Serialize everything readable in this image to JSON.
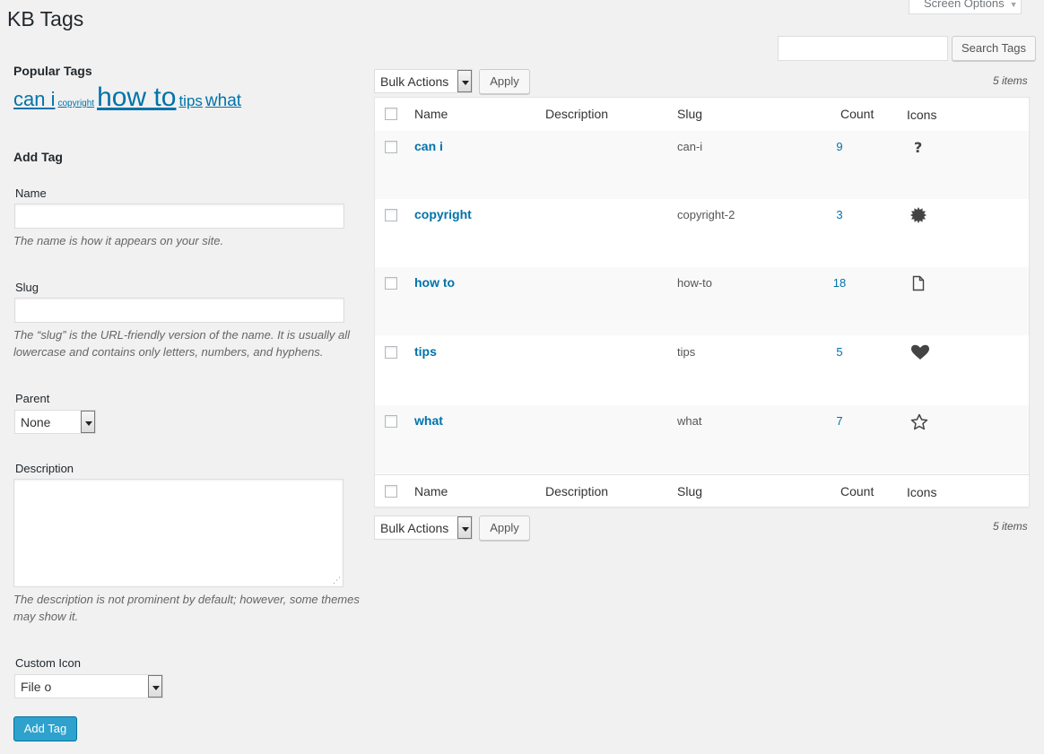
{
  "page": {
    "title": "KB Tags"
  },
  "screen_options": {
    "label": "Screen Options"
  },
  "search": {
    "value": "",
    "button_label": "Search Tags"
  },
  "popular_tags": {
    "heading": "Popular Tags",
    "tags": [
      {
        "label": "can i"
      },
      {
        "label": "copyright"
      },
      {
        "label": "how to"
      },
      {
        "label": "tips"
      },
      {
        "label": "what"
      }
    ]
  },
  "add_tag": {
    "heading": "Add Tag",
    "name_label": "Name",
    "name_value": "",
    "name_hint": "The name is how it appears on your site.",
    "slug_label": "Slug",
    "slug_value": "",
    "slug_hint_1": "The “slug” is the URL-friendly version of the name. It is usually all",
    "slug_hint_2": "lowercase and contains only letters, numbers, and hyphens.",
    "parent_label": "Parent",
    "parent_value": "None",
    "description_label": "Description",
    "description_value": "",
    "description_hint_1": "The description is not prominent by default; however, some themes",
    "description_hint_2": "may show it.",
    "custom_icon_label": "Custom Icon",
    "custom_icon_value": "File o",
    "submit_label": "Add Tag"
  },
  "bulk": {
    "label": "Bulk Actions",
    "apply_label": "Apply",
    "items_count": "5 items"
  },
  "table": {
    "columns": {
      "name": "Name",
      "description": "Description",
      "slug": "Slug",
      "count": "Count",
      "icons": "Icons"
    },
    "rows": [
      {
        "name": "can i",
        "description": "",
        "slug": "can-i",
        "count": "9",
        "icon": "question-icon"
      },
      {
        "name": "copyright",
        "description": "",
        "slug": "copyright-2",
        "count": "3",
        "icon": "certificate-icon"
      },
      {
        "name": "how to",
        "description": "",
        "slug": "how-to",
        "count": "18",
        "icon": "file-icon"
      },
      {
        "name": "tips",
        "description": "",
        "slug": "tips",
        "count": "5",
        "icon": "heart-icon"
      },
      {
        "name": "what",
        "description": "",
        "slug": "what",
        "count": "7",
        "icon": "star-outline-icon"
      }
    ]
  }
}
